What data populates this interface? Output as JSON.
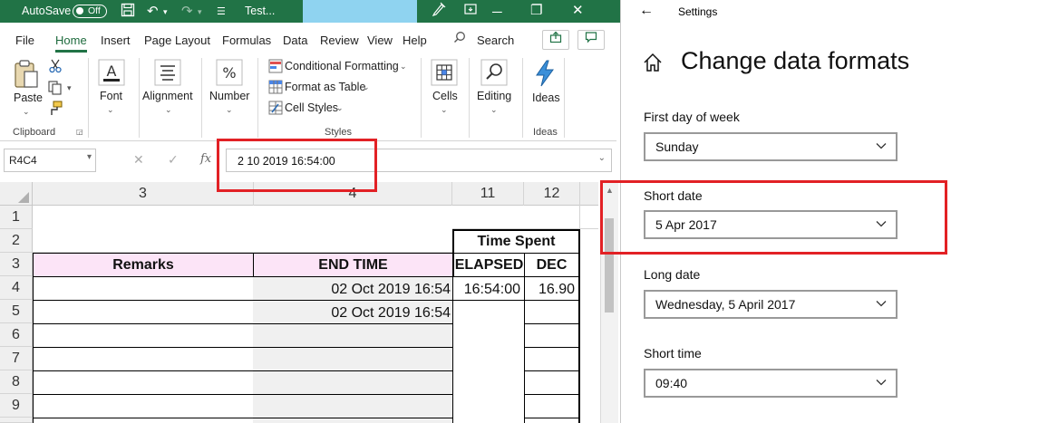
{
  "excel": {
    "titlebar": {
      "autosave_label": "AutoSave",
      "autosave_state": "Off",
      "doc_title": "Test..."
    },
    "menu": [
      "File",
      "Home",
      "Insert",
      "Page Layout",
      "Formulas",
      "Data",
      "Review",
      "View",
      "Help"
    ],
    "search_label": "Search",
    "ribbon": {
      "paste": "Paste",
      "font": "Font",
      "alignment": "Alignment",
      "number": "Number",
      "conditional_formatting": "Conditional Formatting",
      "format_as_table": "Format as Table",
      "cell_styles": "Cell Styles",
      "cells": "Cells",
      "editing": "Editing",
      "ideas": "Ideas",
      "groups": {
        "clipboard": "Clipboard",
        "styles": "Styles",
        "ideas": "Ideas"
      }
    },
    "namebox": "R4C4",
    "formula": "2 10 2019  16:54:00",
    "fx_label": "fx",
    "columns": [
      "3",
      "4",
      "11",
      "12"
    ],
    "rows": [
      "1",
      "2",
      "3",
      "4",
      "5",
      "6",
      "7",
      "8",
      "9"
    ],
    "cells": {
      "time_spent": "Time Spent",
      "remarks": "Remarks",
      "end_time": "END TIME",
      "elapsed": "ELAPSED",
      "dec": "DEC",
      "r4_end": "02 Oct 2019 16:54",
      "r4_elapsed": "16:54:00",
      "r4_dec": "16.90",
      "r5_end": "02 Oct 2019 16:54"
    },
    "colors": {
      "brand": "#217346",
      "header_pink": "#fce4f7",
      "highlight": "#e22125"
    }
  },
  "settings": {
    "window_title": "Settings",
    "heading": "Change data formats",
    "fields": [
      {
        "label": "First day of week",
        "value": "Sunday"
      },
      {
        "label": "Short date",
        "value": "5 Apr 2017"
      },
      {
        "label": "Long date",
        "value": "Wednesday, 5 April 2017"
      },
      {
        "label": "Short time",
        "value": "09:40"
      }
    ]
  }
}
